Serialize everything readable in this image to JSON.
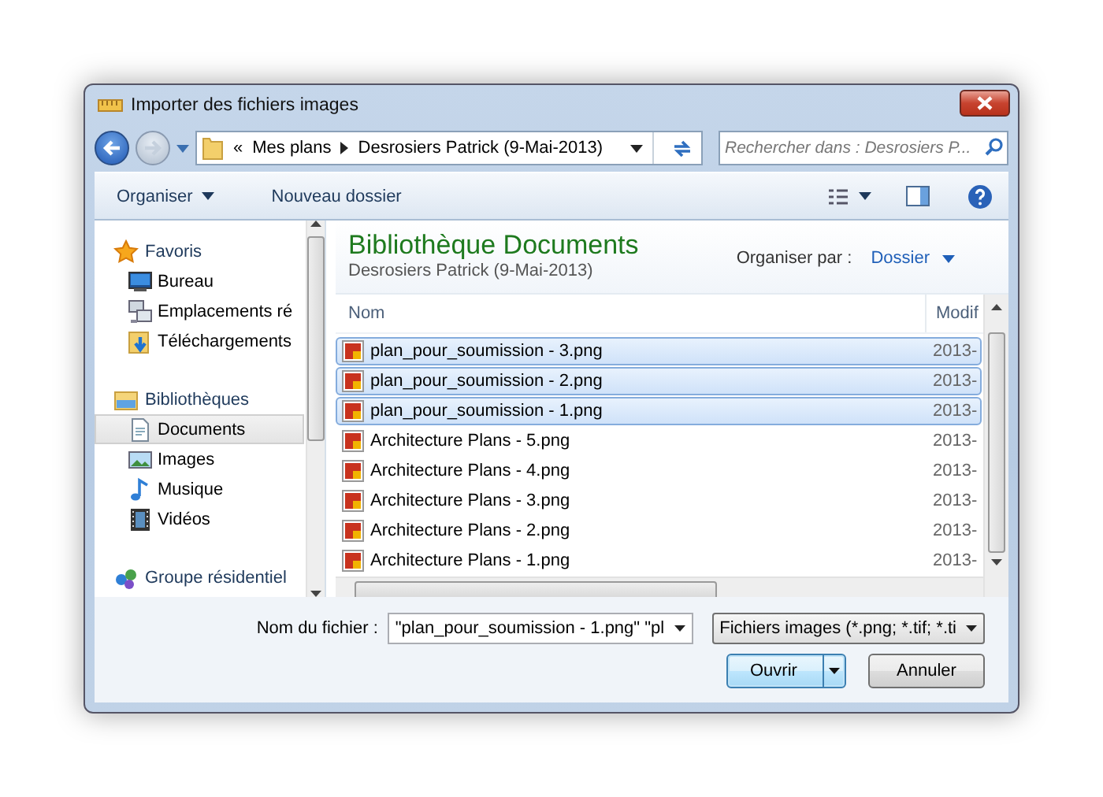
{
  "window": {
    "title": "Importer des fichiers images"
  },
  "address": {
    "overflow": "«",
    "crumbs": [
      "Mes plans",
      "Desrosiers Patrick (9-Mai-2013)"
    ]
  },
  "search": {
    "placeholder": "Rechercher dans : Desrosiers P..."
  },
  "toolbar": {
    "organise": "Organiser",
    "new_folder": "Nouveau dossier"
  },
  "sidebar": {
    "groups": [
      {
        "label": "Favoris",
        "kind": "star",
        "children": [
          {
            "label": "Bureau",
            "kind": "desktop",
            "selected": false
          },
          {
            "label": "Emplacements ré",
            "kind": "places",
            "selected": false
          },
          {
            "label": "Téléchargements",
            "kind": "download",
            "selected": false
          }
        ]
      },
      {
        "label": "Bibliothèques",
        "kind": "library",
        "children": [
          {
            "label": "Documents",
            "kind": "document",
            "selected": true
          },
          {
            "label": "Images",
            "kind": "image",
            "selected": false
          },
          {
            "label": "Musique",
            "kind": "music",
            "selected": false
          },
          {
            "label": "Vidéos",
            "kind": "video",
            "selected": false
          }
        ]
      },
      {
        "label": "Groupe résidentiel",
        "kind": "homegroup"
      }
    ]
  },
  "library": {
    "title": "Bibliothèque Documents",
    "subtitle": "Desrosiers Patrick (9-Mai-2013)",
    "arrange_label": "Organiser par :",
    "arrange_value": "Dossier"
  },
  "table": {
    "columns": [
      "Nom",
      "Modif"
    ],
    "rows": [
      {
        "name": "plan_pour_soumission - 3.png",
        "modified": "2013-",
        "selected": true
      },
      {
        "name": "plan_pour_soumission - 2.png",
        "modified": "2013-",
        "selected": true
      },
      {
        "name": "plan_pour_soumission - 1.png",
        "modified": "2013-",
        "selected": true
      },
      {
        "name": "Architecture Plans - 5.png",
        "modified": "2013-",
        "selected": false
      },
      {
        "name": "Architecture Plans - 4.png",
        "modified": "2013-",
        "selected": false
      },
      {
        "name": "Architecture Plans - 3.png",
        "modified": "2013-",
        "selected": false
      },
      {
        "name": "Architecture Plans - 2.png",
        "modified": "2013-",
        "selected": false
      },
      {
        "name": "Architecture Plans - 1.png",
        "modified": "2013-",
        "selected": false
      }
    ]
  },
  "filename": {
    "label": "Nom du fichier :",
    "value": "\"plan_pour_soumission - 1.png\" \"pl"
  },
  "filetype": {
    "value": "Fichiers images (*.png; *.tif; *.ti"
  },
  "buttons": [
    {
      "label": "Ouvrir",
      "default": true
    },
    {
      "label": "Annuler",
      "default": false
    }
  ]
}
